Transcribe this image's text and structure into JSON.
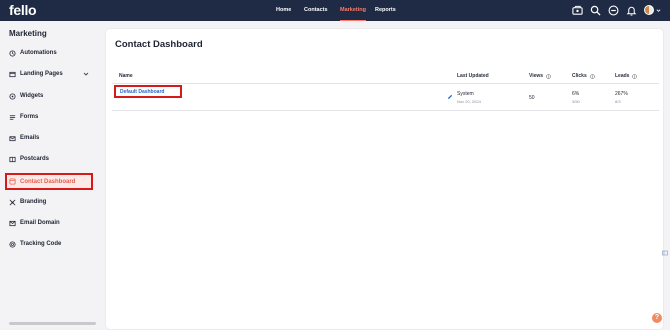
{
  "app": {
    "logo": "fello"
  },
  "topnav": {
    "items": [
      {
        "label": "Home",
        "active": false
      },
      {
        "label": "Contacts",
        "active": false
      },
      {
        "label": "Marketing",
        "active": true
      },
      {
        "label": "Reports",
        "active": false
      }
    ],
    "icons": [
      "credits-icon",
      "search-icon",
      "minus-circle-icon",
      "bell-icon",
      "avatar"
    ]
  },
  "sidebar": {
    "title": "Marketing",
    "items": [
      {
        "label": "Automations",
        "icon": "automation-icon"
      },
      {
        "label": "Landing Pages",
        "icon": "landing-page-icon",
        "expandable": true
      },
      {
        "label": "Widgets",
        "icon": "widget-icon"
      },
      {
        "label": "Forms",
        "icon": "form-icon"
      },
      {
        "label": "Emails",
        "icon": "email-icon"
      },
      {
        "label": "Postcards",
        "icon": "postcard-icon"
      },
      {
        "label": "Contact Dashboard",
        "icon": "dashboard-icon",
        "active": true
      },
      {
        "label": "Branding",
        "icon": "branding-icon"
      },
      {
        "label": "Email Domain",
        "icon": "domain-icon"
      },
      {
        "label": "Tracking Code",
        "icon": "tracking-icon"
      }
    ]
  },
  "main": {
    "title": "Contact Dashboard",
    "columns": {
      "name": "Name",
      "last_updated": "Last Updated",
      "views": "Views",
      "clicks": "Clicks",
      "leads": "Leads"
    },
    "rows": [
      {
        "name": "Default Dashboard",
        "last_updated": "System",
        "last_updated_date": "Nov 20, 2024",
        "views": "50",
        "clicks": "6%",
        "clicks_sub": "3/50",
        "leads": "267%",
        "leads_sub": "8/3"
      }
    ]
  },
  "colors": {
    "topbar": "#1f2a44",
    "accent": "#ff7a6b",
    "link": "#2a66c8",
    "highlight": "#d61a1a",
    "help": "#f08a62"
  },
  "help": {
    "label": "?"
  }
}
